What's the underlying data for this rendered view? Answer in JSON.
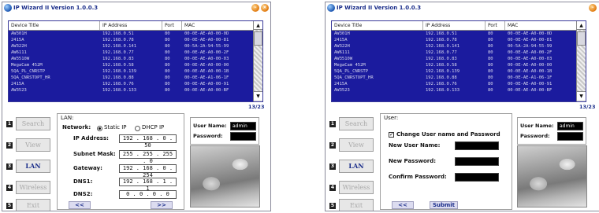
{
  "window": {
    "title": "IP Wizard II  Version 1.0.0.3",
    "minimize_symbol": "–",
    "close_symbol": "×"
  },
  "table": {
    "columns": [
      "Device Title",
      "IP Address",
      "Port",
      "MAC"
    ],
    "rows": [
      [
        "AW301H",
        "192.168.0.51",
        "80",
        "00-0E-AE-A0-00-0D"
      ],
      [
        "2415A",
        "192.168.0.78",
        "80",
        "00-0E-AE-A0-00-81"
      ],
      [
        "AW322H",
        "192.168.0.141",
        "80",
        "00-5A-2A-94-55-99"
      ],
      [
        "AW6111",
        "192.168.0.77",
        "80",
        "00-0E-AE-A0-00-2F"
      ],
      [
        "AW3510W",
        "192.168.0.83",
        "80",
        "00-0E-AE-A0-00-03"
      ],
      [
        "MegaCam 452M",
        "192.168.0.58",
        "80",
        "00-0E-AE-A0-00-00"
      ],
      [
        "5QA_PL_CNRSTP",
        "192.168.0.139",
        "80",
        "00-0E-AE-A0-00-1B"
      ],
      [
        "5QA_CNRSTOPT_HR",
        "192.168.0.88",
        "80",
        "00-0E-AE-A1-06-1F"
      ],
      [
        "2415A",
        "192.168.0.76",
        "80",
        "00-0E-AE-A0-00-91"
      ],
      [
        "AW3523",
        "192.168.0.133",
        "80",
        "00-0E-AE-A0-00-BF"
      ]
    ],
    "scroll_up_symbol": "▲",
    "scroll_down_symbol": "▼"
  },
  "counter": "13/23",
  "sidebar": {
    "items": [
      {
        "num": "1",
        "label": "Search"
      },
      {
        "num": "2",
        "label": "View"
      },
      {
        "num": "3",
        "label": "LAN"
      },
      {
        "num": "4",
        "label": "Wireless"
      },
      {
        "num": "5",
        "label": "Exit"
      }
    ]
  },
  "lan": {
    "legend": "LAN:",
    "network_label": "Network:",
    "static_label": "Static IP",
    "dhcp_label": "DHCP IP",
    "ip_label": "IP Address:",
    "ip_value": "192 . 168 . 0  . 50",
    "mask_label": "Subnet Mask:",
    "mask_value": "255 . 255 . 255 . 0",
    "gateway_label": "Gateway:",
    "gateway_value": "192 . 168 . 0  . 254",
    "dns1_label": "DNS1:",
    "dns1_value": "192 . 168 . 1  . 1",
    "dns2_label": "DNS2:",
    "dns2_value": "0 .  0 .  0 .  0",
    "prev_label": "<<",
    "next_label": ">>"
  },
  "user": {
    "legend": "User:",
    "change_label": "Change User name and Password",
    "change_checked": "✓",
    "new_user_label": "New User Name:",
    "new_password_label": "New Password:",
    "confirm_password_label": "Confirm Password:",
    "prev_label": "<<",
    "submit_label": "Submit"
  },
  "login": {
    "user_label": "User Name:",
    "user_value": "admin",
    "password_label": "Password:"
  },
  "colors": {
    "table_bg": "#1b1b9e",
    "accent": "#1a2d8a"
  }
}
